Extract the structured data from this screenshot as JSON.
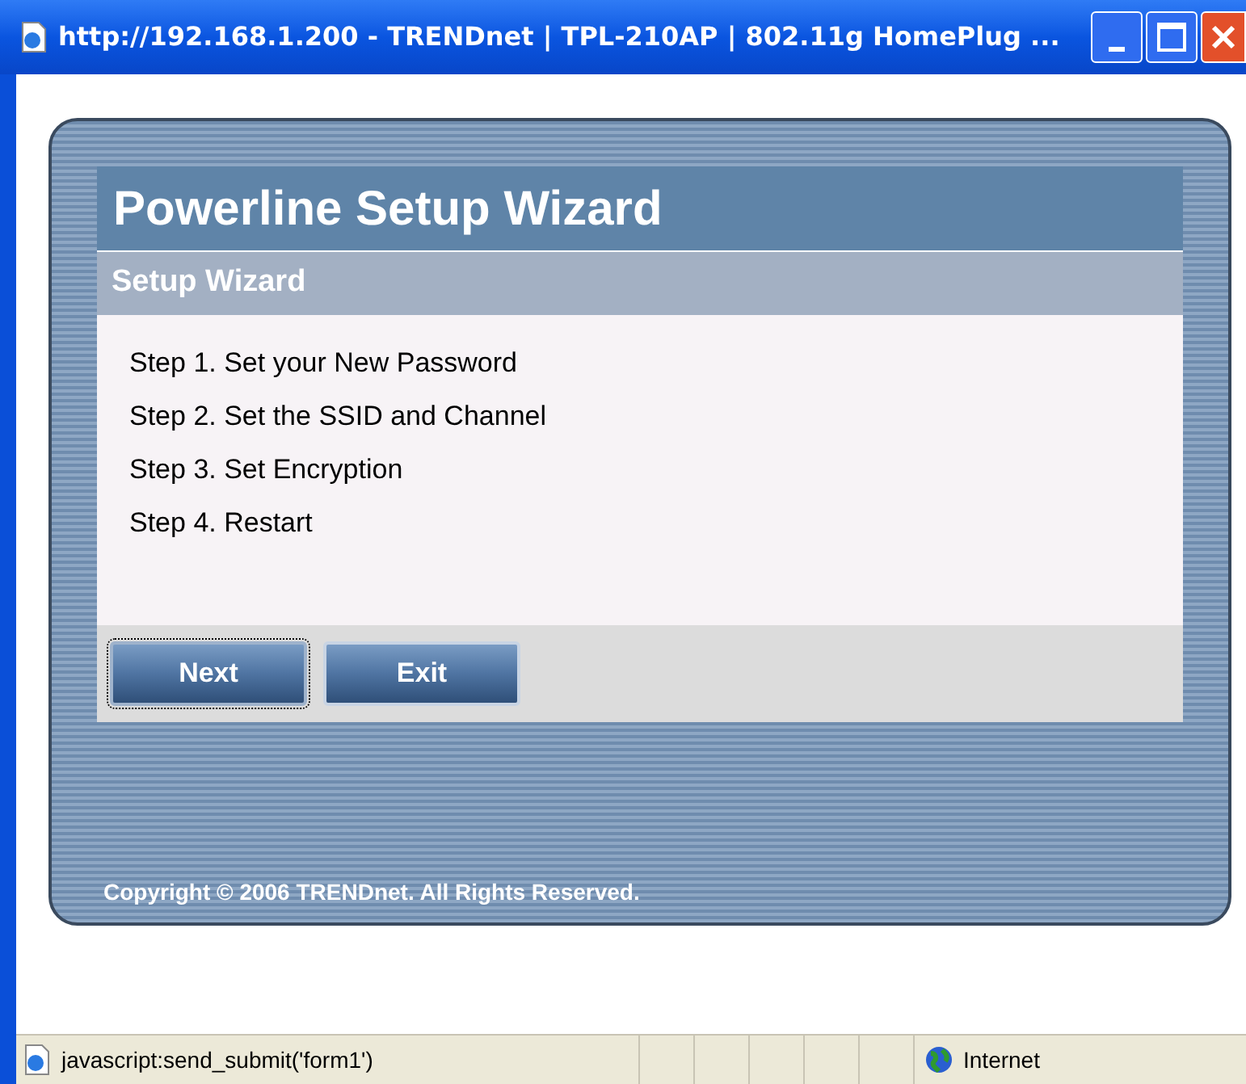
{
  "window": {
    "title": "http://192.168.1.200 - TRENDnet | TPL-210AP | 802.11g HomePlug ..."
  },
  "wizard": {
    "title": "Powerline Setup Wizard",
    "section": "Setup Wizard",
    "steps": [
      "Step 1. Set your New Password",
      "Step 2. Set the SSID and Channel",
      "Step 3. Set Encryption",
      "Step 4. Restart"
    ],
    "buttons": [
      {
        "label": "Next",
        "focused": true
      },
      {
        "label": "Exit",
        "focused": false
      }
    ],
    "copyright": "Copyright © 2006 TRENDnet. All Rights Reserved."
  },
  "status_bar": {
    "text": "javascript:send_submit('form1')",
    "zone": "Internet"
  }
}
